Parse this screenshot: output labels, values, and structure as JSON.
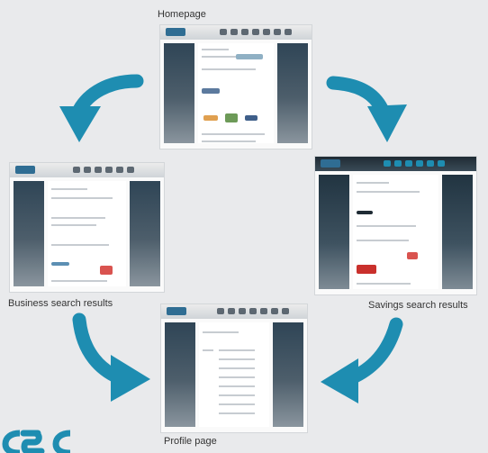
{
  "diagram": {
    "captions": {
      "homepage": "Homepage",
      "business": "Business search results",
      "savings": "Savings search results",
      "profile": "Profile page"
    }
  },
  "colors": {
    "arrow": "#1e8db1",
    "logo": "#1e8db1"
  }
}
